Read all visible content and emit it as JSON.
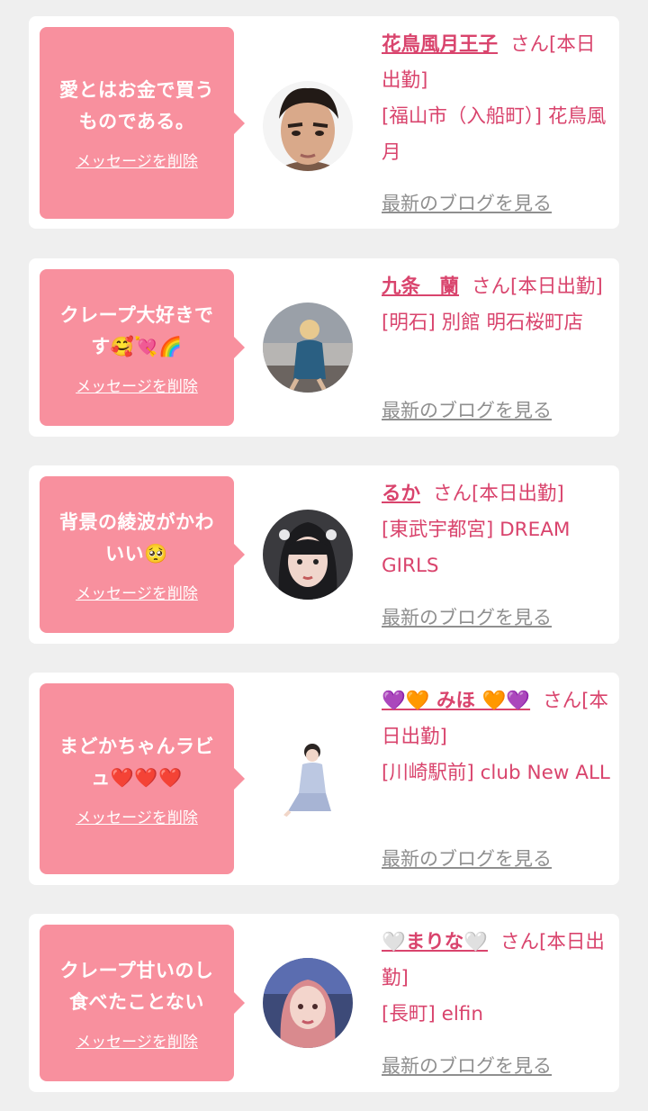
{
  "items": [
    {
      "message": "愛とはお金で買うものである。",
      "delete_label": "メッセージを削除",
      "name": "花鳥風月王子",
      "suffix": "さん[本日出勤]",
      "location": "[福山市（入船町）] 花鳥風月",
      "blog_label": "最新のブログを見る"
    },
    {
      "message": "クレープ大好きです🥰💘🌈",
      "delete_label": "メッセージを削除",
      "name": "九条　蘭",
      "suffix": "さん[本日出勤]",
      "location": "[明石] 別館 明石桜町店",
      "blog_label": "最新のブログを見る"
    },
    {
      "message": "背景の綾波がかわいい🥺",
      "delete_label": "メッセージを削除",
      "name": "るか",
      "suffix": "さん[本日出勤]",
      "location": "[東武宇都宮] DREAM GIRLS",
      "blog_label": "最新のブログを見る"
    },
    {
      "message": "まどかちゃんラビュ❤️❤️❤️",
      "delete_label": "メッセージを削除",
      "name": "💜🧡 みほ 🧡💜",
      "suffix": "さん[本日出勤]",
      "location": "[川崎駅前] club New ALL",
      "blog_label": "最新のブログを見る"
    },
    {
      "message": "クレープ甘いのし食べたことない",
      "delete_label": "メッセージを削除",
      "name": "🤍まりな🤍",
      "suffix": "さん[本日出勤]",
      "location": "[長町] elfin",
      "blog_label": "最新のブログを見る"
    }
  ],
  "colors": {
    "bubble": "#f8909e",
    "name": "#d9446d",
    "link_gray": "#8f8f8f",
    "background": "#efefef"
  }
}
